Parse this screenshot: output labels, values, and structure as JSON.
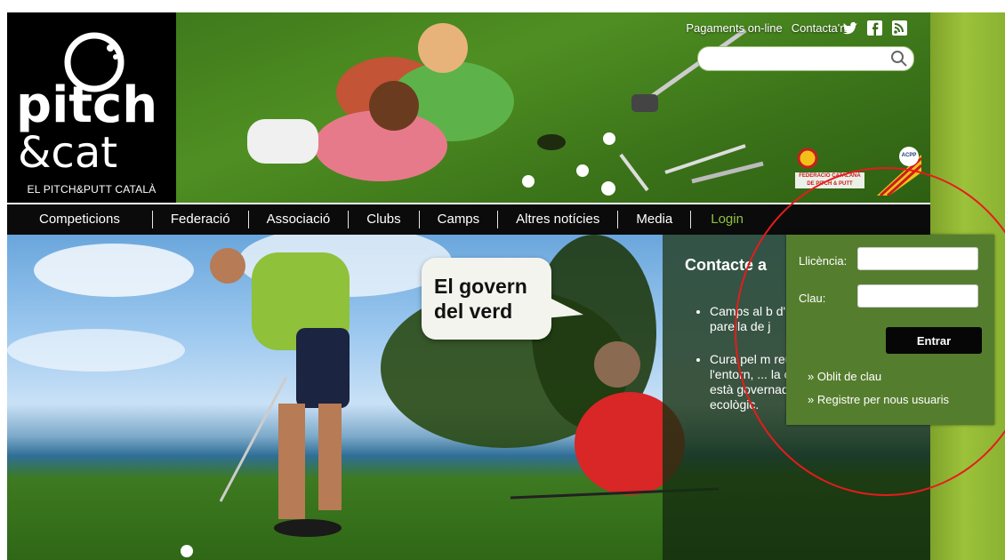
{
  "logo": {
    "word1": "pitch",
    "word2": "&cat",
    "tagline": "EL PITCH&PUTT CATALÀ"
  },
  "header": {
    "links": [
      "Pagaments on-line",
      "Contacta'ns"
    ],
    "search": {
      "value": "",
      "placeholder": ""
    },
    "federation_logo_text": "FEDERACIÓ CATALANA DE PITCH & PUTT",
    "acpp_logo_text": "ACPP"
  },
  "nav": {
    "items": [
      "Competicions",
      "Federació",
      "Associació",
      "Clubs",
      "Camps",
      "Altres notícies",
      "Media",
      "Login"
    ],
    "active": "Login"
  },
  "hero": {
    "bubble_line1": "El govern",
    "bubble_line2": "del verd",
    "panel_title": "Contacte a",
    "panel_items": [
      "Camps al b d'indrets e natura és l parella de j",
      "Cura pel m reutilització integració a l'entorn, ... la cultura del picth&putt està governada pel verd més ecològic."
    ]
  },
  "login": {
    "licence_label": "Llicència:",
    "licence_value": "",
    "password_label": "Clau:",
    "password_value": "",
    "submit_label": "Entrar",
    "forgot_link": "» Oblit de clau",
    "register_link": "» Registre per nous usuaris"
  },
  "colors": {
    "nav_bg": "#0b0b0b",
    "login_bg": "#557d2e",
    "login_active": "#8fc142",
    "annotation": "#e51c1c"
  }
}
